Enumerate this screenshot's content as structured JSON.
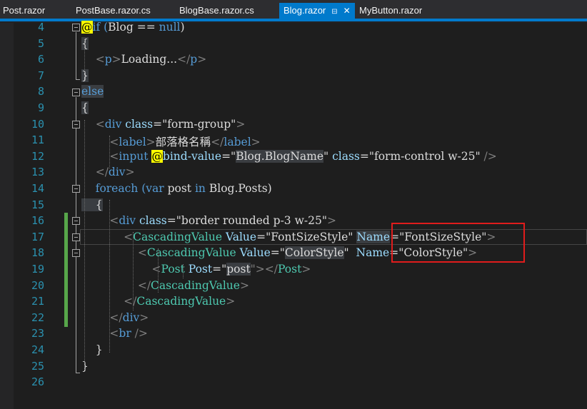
{
  "tabs": [
    {
      "label": "Post.razor",
      "active": false
    },
    {
      "label": "PostBase.razor.cs",
      "active": false
    },
    {
      "label": "BlogBase.razor.cs",
      "active": false
    },
    {
      "label": "Blog.razor",
      "active": true,
      "pin_icon": "pin-icon",
      "close_icon": "close-icon"
    },
    {
      "label": "MyButton.razor",
      "active": false
    }
  ],
  "editor": {
    "accent_color": "#007acc",
    "highlight_box_color": "#e01c1c",
    "line_numbers": [
      "4",
      "5",
      "6",
      "7",
      "8",
      "9",
      "10",
      "11",
      "12",
      "13",
      "14",
      "15",
      "16",
      "17",
      "18",
      "19",
      "20",
      "21",
      "22",
      "23",
      "24",
      "25",
      "26"
    ],
    "lines": [
      [
        {
          "t": "@",
          "c": "tok-razor"
        },
        {
          "t": "if (",
          "c": "tok-kw"
        },
        {
          "t": "Blog",
          "c": "tok-id"
        },
        {
          "t": " == ",
          "c": "tok-id"
        },
        {
          "t": "null",
          "c": "tok-kw"
        },
        {
          "t": ")",
          "c": "tok-id"
        }
      ],
      [
        {
          "t": "{",
          "c": "tok-hl"
        }
      ],
      [
        {
          "t": "    <",
          "c": "tok-tag"
        },
        {
          "t": "p",
          "c": "tok-name"
        },
        {
          "t": ">",
          "c": "tok-tag"
        },
        {
          "t": "Loading...",
          "c": "tok-id"
        },
        {
          "t": "</",
          "c": "tok-tag"
        },
        {
          "t": "p",
          "c": "tok-name"
        },
        {
          "t": ">",
          "c": "tok-tag"
        }
      ],
      [
        {
          "t": "}",
          "c": "tok-hl"
        }
      ],
      [
        {
          "t": "else",
          "c": "tok-kw tok-hl"
        }
      ],
      [
        {
          "t": "{",
          "c": "tok-hl"
        }
      ],
      [
        {
          "t": "    <",
          "c": "tok-tag"
        },
        {
          "t": "div",
          "c": "tok-name"
        },
        {
          "t": " class",
          "c": "tok-attr"
        },
        {
          "t": "=",
          "c": "tok-id"
        },
        {
          "t": "\"form-group\"",
          "c": "tok-str"
        },
        {
          "t": ">",
          "c": "tok-tag"
        }
      ],
      [
        {
          "t": "        <",
          "c": "tok-tag"
        },
        {
          "t": "label",
          "c": "tok-name"
        },
        {
          "t": ">",
          "c": "tok-tag"
        },
        {
          "t": "部落格名稱",
          "c": "tok-id"
        },
        {
          "t": "</",
          "c": "tok-tag"
        },
        {
          "t": "label",
          "c": "tok-name"
        },
        {
          "t": ">",
          "c": "tok-tag"
        }
      ],
      [
        {
          "t": "        <",
          "c": "tok-tag"
        },
        {
          "t": "input",
          "c": "tok-name"
        },
        {
          "t": " ",
          "c": "tok-id"
        },
        {
          "t": "@",
          "c": "tok-razor"
        },
        {
          "t": "bind-value",
          "c": "tok-attr"
        },
        {
          "t": "=\"",
          "c": "tok-id"
        },
        {
          "t": "Blog.BlogName",
          "c": "tok-id tok-hl"
        },
        {
          "t": "\"",
          "c": "tok-id"
        },
        {
          "t": " class",
          "c": "tok-attr"
        },
        {
          "t": "=",
          "c": "tok-id"
        },
        {
          "t": "\"form-control w-25\"",
          "c": "tok-str"
        },
        {
          "t": " />",
          "c": "tok-tag"
        }
      ],
      [
        {
          "t": "    </",
          "c": "tok-tag"
        },
        {
          "t": "div",
          "c": "tok-name"
        },
        {
          "t": ">",
          "c": "tok-tag"
        }
      ],
      [
        {
          "t": "    foreach (",
          "c": "tok-kw"
        },
        {
          "t": "var",
          "c": "tok-kw"
        },
        {
          "t": " post ",
          "c": "tok-id"
        },
        {
          "t": "in",
          "c": "tok-kw"
        },
        {
          "t": " Blog.Posts)",
          "c": "tok-id"
        }
      ],
      [
        {
          "t": "    {",
          "c": "tok-hl"
        }
      ],
      [
        {
          "t": "        <",
          "c": "tok-tag"
        },
        {
          "t": "div",
          "c": "tok-name"
        },
        {
          "t": " class",
          "c": "tok-attr"
        },
        {
          "t": "=",
          "c": "tok-id"
        },
        {
          "t": "\"border rounded p-3 w-25\"",
          "c": "tok-str"
        },
        {
          "t": ">",
          "c": "tok-tag"
        }
      ],
      [
        {
          "t": "            <",
          "c": "tok-tag"
        },
        {
          "t": "CascadingValue",
          "c": "tok-comp"
        },
        {
          "t": " Value",
          "c": "tok-attr"
        },
        {
          "t": "=",
          "c": "tok-id"
        },
        {
          "t": "\"FontSizeStyle\"",
          "c": "tok-str"
        },
        {
          "t": " ",
          "c": "tok-id"
        },
        {
          "t": "Name",
          "c": "tok-attr tok-hl"
        },
        {
          "t": "=",
          "c": "tok-id"
        },
        {
          "t": "\"FontSizeStyle\"",
          "c": "tok-str"
        },
        {
          "t": ">",
          "c": "tok-tag"
        }
      ],
      [
        {
          "t": "                <",
          "c": "tok-tag"
        },
        {
          "t": "CascadingValue",
          "c": "tok-comp"
        },
        {
          "t": " Value",
          "c": "tok-attr"
        },
        {
          "t": "=",
          "c": "tok-id"
        },
        {
          "t": "\"",
          "c": "tok-str"
        },
        {
          "t": "ColorStyle",
          "c": "tok-str tok-hl"
        },
        {
          "t": "\"",
          "c": "tok-str"
        },
        {
          "t": "  ",
          "c": "tok-id"
        },
        {
          "t": "Name",
          "c": "tok-attr"
        },
        {
          "t": "=",
          "c": "tok-id"
        },
        {
          "t": "\"ColorStyle\"",
          "c": "tok-str"
        },
        {
          "t": ">",
          "c": "tok-tag"
        }
      ],
      [
        {
          "t": "                    <",
          "c": "tok-tag"
        },
        {
          "t": "Post",
          "c": "tok-comp"
        },
        {
          "t": " Post",
          "c": "tok-attr"
        },
        {
          "t": "=\"",
          "c": "tok-id"
        },
        {
          "t": "post",
          "c": "tok-id tok-hl"
        },
        {
          "t": "\"></",
          "c": "tok-tag"
        },
        {
          "t": "Post",
          "c": "tok-comp"
        },
        {
          "t": ">",
          "c": "tok-tag"
        }
      ],
      [
        {
          "t": "                </",
          "c": "tok-tag"
        },
        {
          "t": "CascadingValue",
          "c": "tok-comp"
        },
        {
          "t": ">",
          "c": "tok-tag"
        }
      ],
      [
        {
          "t": "            </",
          "c": "tok-tag"
        },
        {
          "t": "CascadingValue",
          "c": "tok-comp"
        },
        {
          "t": ">",
          "c": "tok-tag"
        }
      ],
      [
        {
          "t": "        </",
          "c": "tok-tag"
        },
        {
          "t": "div",
          "c": "tok-name"
        },
        {
          "t": ">",
          "c": "tok-tag"
        }
      ],
      [
        {
          "t": "        <",
          "c": "tok-tag"
        },
        {
          "t": "br",
          "c": "tok-name"
        },
        {
          "t": " />",
          "c": "tok-tag"
        }
      ],
      [
        {
          "t": "    }",
          "c": "tok-id"
        }
      ],
      [
        {
          "t": "}",
          "c": "tok-id"
        }
      ],
      [
        {
          "t": "",
          "c": "tok-id"
        }
      ]
    ]
  }
}
